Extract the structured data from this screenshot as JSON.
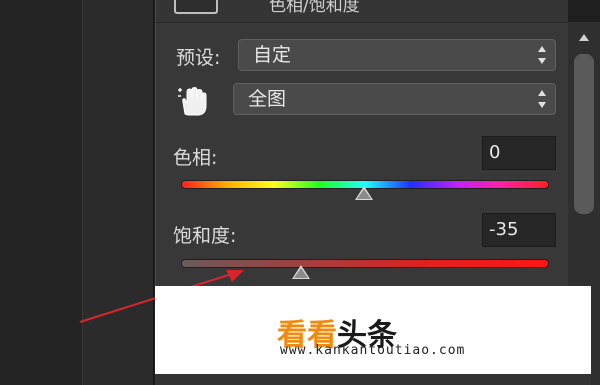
{
  "panel": {
    "title": "色相/饱和度",
    "preset_label": "预设:",
    "preset_value": "自定",
    "channel_value": "全图",
    "hue_label": "色相:",
    "hue_value": "0",
    "saturation_label": "饱和度:",
    "saturation_value": "-35"
  },
  "watermark": {
    "brand_part1": "看看",
    "brand_part2": "头条",
    "url": "www.kankantoutiao.com"
  },
  "colors": {
    "annotation_arrow": "#d9262c",
    "watermark_orange": "#f28a10"
  },
  "icons": [
    "hand-targeted-adjustment-icon",
    "select-arrows-icon",
    "slider-thumb-icon",
    "scroll-up-icon"
  ]
}
